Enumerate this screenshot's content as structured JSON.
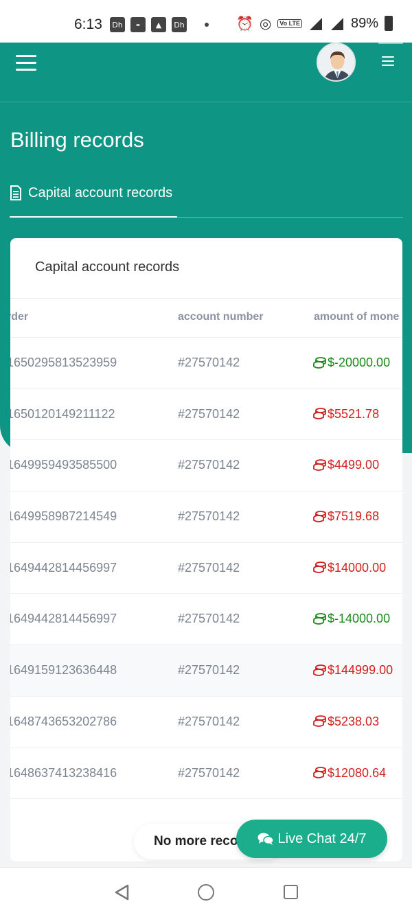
{
  "status_bar": {
    "time": "6:13",
    "battery": "89%",
    "network": "4G",
    "left_icons": [
      "dh-icon",
      "news-icon",
      "image-icon",
      "dh-icon"
    ],
    "right_icons": [
      "alarm-icon",
      "hotspot-icon",
      "volte-icon",
      "signal-icon",
      "battery-icon"
    ]
  },
  "header": {
    "page_title": "Billing records",
    "tab_label": "Capital account records"
  },
  "card": {
    "title": "Capital account records",
    "columns": [
      "order",
      "account number",
      "amount of money"
    ],
    "columns_visible": [
      "rder",
      "account number",
      "amount of mone"
    ],
    "rows": [
      {
        "order": "1650295813523959",
        "account": "#27570142",
        "amount": "$-20000.00",
        "sign": "positive"
      },
      {
        "order": "1650120149211122",
        "account": "#27570142",
        "amount": "$5521.78",
        "sign": "negative"
      },
      {
        "order": "1649959493585500",
        "account": "#27570142",
        "amount": "$4499.00",
        "sign": "negative"
      },
      {
        "order": "1649958987214549",
        "account": "#27570142",
        "amount": "$7519.68",
        "sign": "negative"
      },
      {
        "order": "1649442814456997",
        "account": "#27570142",
        "amount": "$14000.00",
        "sign": "negative"
      },
      {
        "order": "1649442814456997",
        "account": "#27570142",
        "amount": "$-14000.00",
        "sign": "positive"
      },
      {
        "order": "1649159123636448",
        "account": "#27570142",
        "amount": "$144999.00",
        "sign": "negative"
      },
      {
        "order": "1648743653202786",
        "account": "#27570142",
        "amount": "$5238.03",
        "sign": "negative"
      },
      {
        "order": "1648637413238416",
        "account": "#27570142",
        "amount": "$12080.64",
        "sign": "negative"
      }
    ]
  },
  "footer": {
    "no_more": "No more reco",
    "live_chat": "Live Chat 24/7"
  },
  "colors": {
    "teal": "#0e9583",
    "green_amount": "#1a8a1a",
    "red_amount": "#d51f1f",
    "chat_button": "#1aae8d"
  }
}
